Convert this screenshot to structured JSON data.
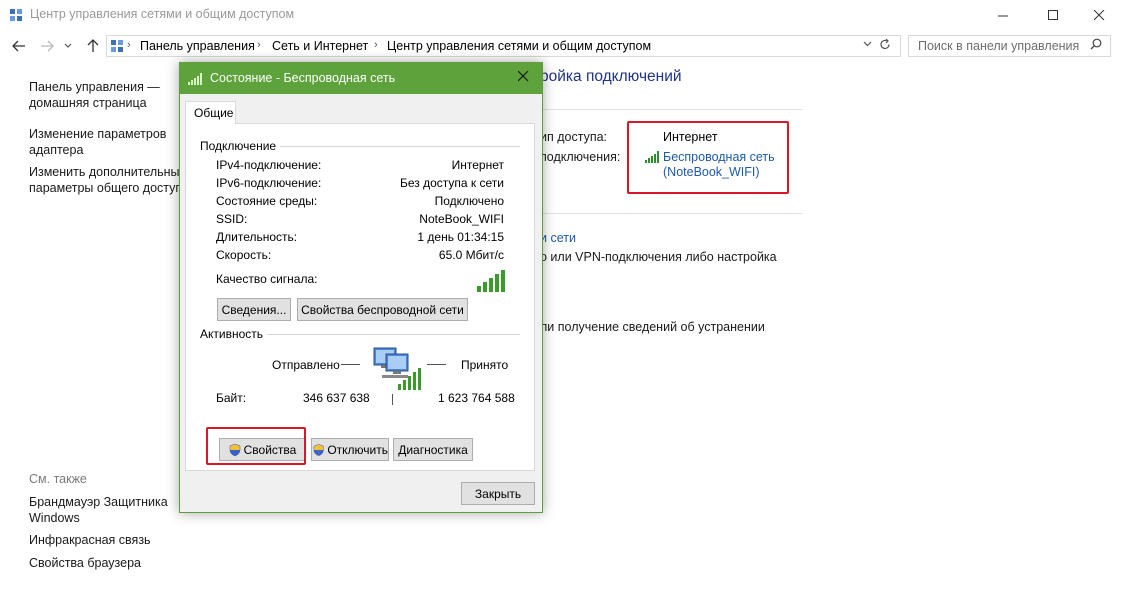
{
  "window": {
    "title": "Центр управления сетями и общим доступом",
    "icon": "control-panel-icon"
  },
  "address": {
    "crumbs": [
      "Панель управления",
      "Сеть и Интернет",
      "Центр управления сетями и общим доступом"
    ],
    "search_placeholder": "Поиск в панели управления"
  },
  "left_pane": {
    "links": [
      "Панель управления —\nдомашняя страница",
      "Изменение параметров\nадаптера",
      "Изменить дополнительные\nпараметры общего доступа"
    ],
    "see_also_title": "См. также",
    "see_also": [
      "Брандмауэр Защитника\nWindows",
      "Инфракрасная связь",
      "Свойства браузера"
    ]
  },
  "main": {
    "heading": "ройка подключений",
    "access_type_label": "ип доступа:",
    "connections_label": "подключения:",
    "access_type_value": "Интернет",
    "connection_link": "Беспроводная сеть\n(NoteBook_WIFI)",
    "settings_link": "и сети",
    "vpn_text": "о или VPN-подключения либо настройка",
    "troubleshoot_text": "ли получение сведений об устранении"
  },
  "dialog": {
    "title": "Состояние - Беспроводная сеть",
    "tab": "Общие",
    "connection_group": "Подключение",
    "rows": [
      {
        "label": "IPv4-подключение:",
        "value": "Интернет"
      },
      {
        "label": "IPv6-подключение:",
        "value": "Без доступа к сети"
      },
      {
        "label": "Состояние среды:",
        "value": "Подключено"
      },
      {
        "label": "SSID:",
        "value": "NoteBook_WIFI"
      },
      {
        "label": "Длительность:",
        "value": "1 день 01:34:15"
      },
      {
        "label": "Скорость:",
        "value": "65.0 Мбит/с"
      }
    ],
    "signal_label": "Качество сигнала:",
    "signal_bars": 5,
    "details_button": "Сведения...",
    "wireless_props_button": "Свойства беспроводной сети",
    "activity_group": "Активность",
    "sent_label": "Отправлено",
    "received_label": "Принято",
    "bytes_label": "Байт:",
    "bytes_sent": "346 637 638",
    "bytes_received": "1 623 764 588",
    "properties_button": "Свойства",
    "disable_button": "Отключить",
    "diagnose_button": "Диагностика",
    "close_button": "Закрыть"
  },
  "colors": {
    "dialog_title_bar": "#5ea23c",
    "link": "#1e5aa8",
    "heading": "#1e3287",
    "highlight_box": "#d8172a"
  }
}
